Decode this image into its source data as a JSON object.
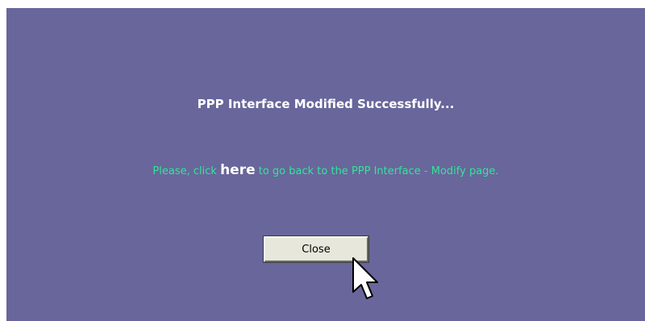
{
  "dialog": {
    "title": "PPP Interface Modified Successfully...",
    "message_before": "Please, click ",
    "link_label": "here",
    "message_after": " to go back to the PPP Interface - Modify page.",
    "close_label": "Close"
  },
  "colors": {
    "background": "#68669b",
    "title_text": "#ffffff",
    "message_text": "#36e39a",
    "button_face": "#e7e7dc"
  },
  "icons": {
    "cursor": "mouse-pointer-icon"
  }
}
